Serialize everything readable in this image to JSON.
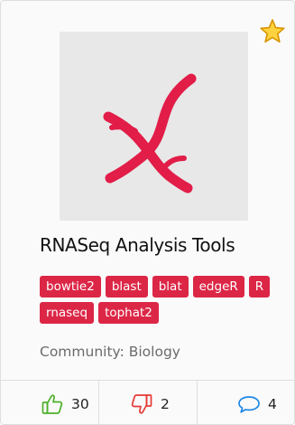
{
  "card": {
    "title": "RNASeq Analysis Tools",
    "tags": [
      "bowtie2",
      "blast",
      "blat",
      "edgeR",
      "R",
      "rnaseq",
      "tophat2"
    ],
    "community": "Community: Biology",
    "likes": "30",
    "dislikes": "2",
    "comments": "4"
  },
  "icons": {
    "favorite": "star-icon",
    "thumbnail": "dna-helix-icon",
    "like": "thumbs-up-icon",
    "dislike": "thumbs-down-icon",
    "comment": "speech-bubble-icon"
  },
  "colors": {
    "tag_background": "#dc2646",
    "helix": "#e11d48",
    "like": "#4caf2a",
    "dislike": "#e53935",
    "comment": "#1e88e5",
    "star": "#ffd23f"
  }
}
